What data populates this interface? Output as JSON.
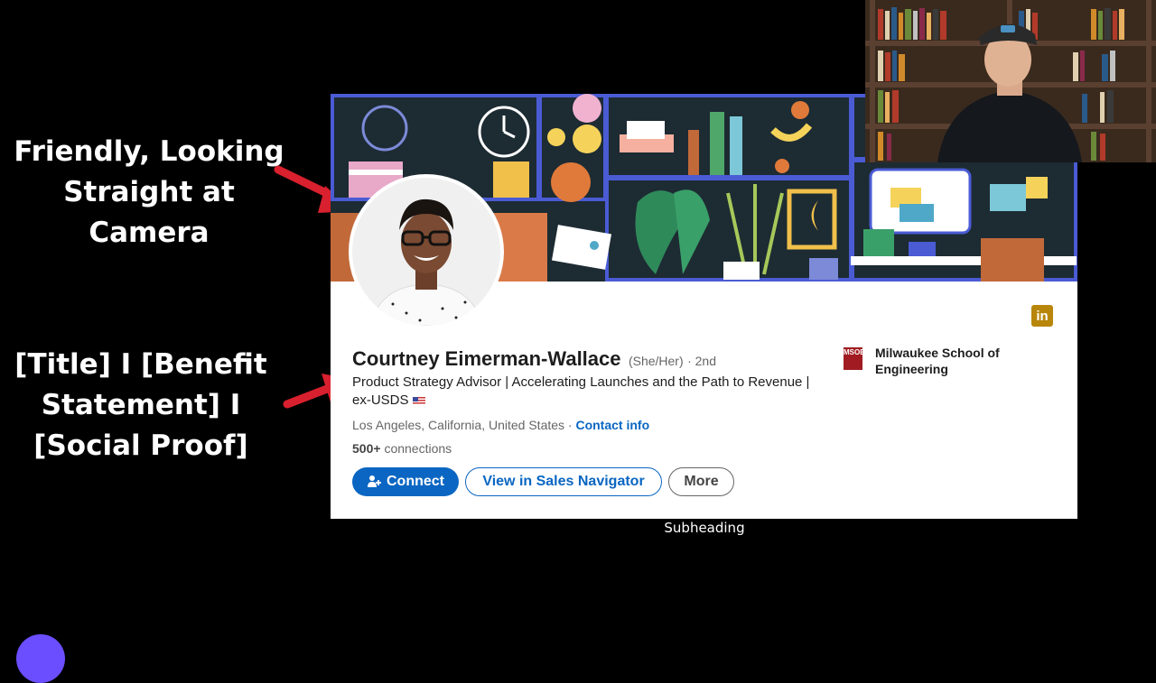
{
  "annotations": {
    "photo_tip": "Friendly, Looking Straight at Camera",
    "headline_tip": "[Title] I [Benefit Statement] I [Social Proof]"
  },
  "profile": {
    "name": "Courtney Eimerman-Wallace",
    "pronouns": "(She/Her)",
    "degree": "· 2nd",
    "headline": "Product Strategy Advisor | Accelerating Launches and the Path to Revenue | ex-USDS",
    "location": "Los Angeles, California, United States ·",
    "contact_link": "Contact info",
    "connections_count": "500+",
    "connections_label": "connections",
    "school_name": "Milwaukee School of Engineering",
    "school_logo_text": "MSOE"
  },
  "buttons": {
    "connect": "Connect",
    "sales_navigator": "View in Sales Navigator",
    "more": "More"
  },
  "caption": "Subheading",
  "icons": {
    "linkedin": "linkedin-icon",
    "connect": "add-person-icon",
    "flag": "us-flag-icon"
  },
  "colors": {
    "linkedin_blue": "#0a66c2",
    "arrow_red": "#d8202e",
    "banner_dark": "#1d2b33",
    "banner_orange": "#c2693a"
  }
}
